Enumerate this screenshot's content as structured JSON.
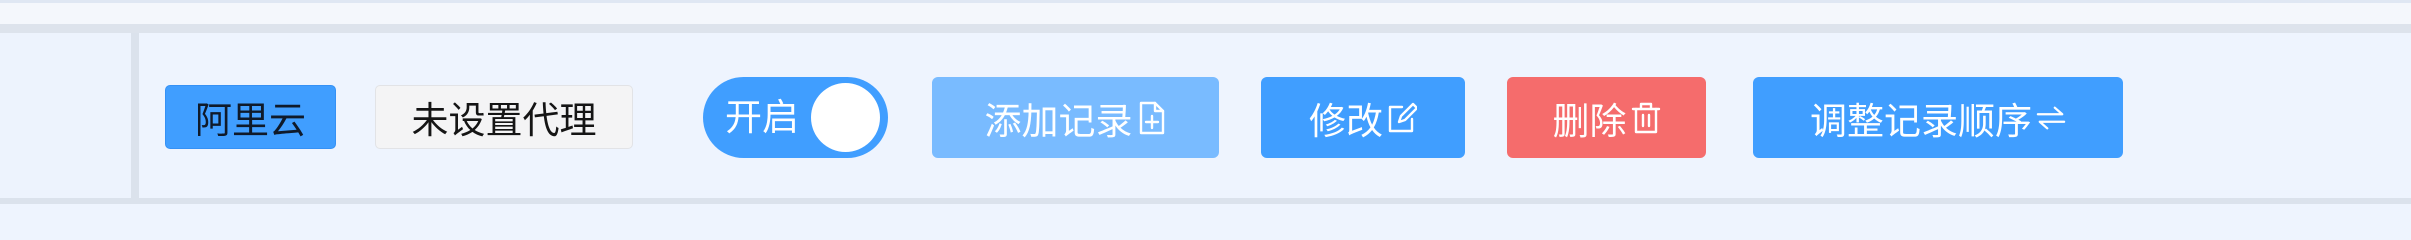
{
  "toolbar": {
    "provider_tag": "阿里云",
    "proxy_tag": "未设置代理",
    "switch_label": "开启",
    "add_record_label": "添加记录",
    "edit_label": "修改",
    "delete_label": "删除",
    "reorder_label": "调整记录顺序"
  },
  "icons": {
    "add": "file-add-icon",
    "edit": "edit-icon",
    "delete": "trash-icon",
    "reorder": "swap-icon"
  },
  "colors": {
    "primary": "#409eff",
    "primary_light": "#79bbff",
    "danger": "#f56c6c",
    "tag_neutral": "#f4f4f5",
    "background": "#eef4fe"
  }
}
